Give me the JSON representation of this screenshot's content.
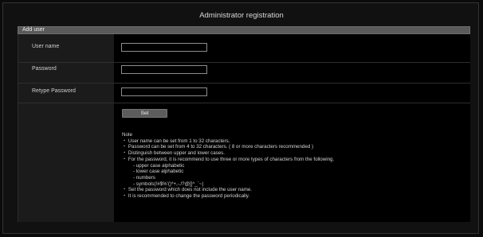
{
  "page": {
    "title": "Administrator registration",
    "section_title": "Add user"
  },
  "form": {
    "fields": [
      {
        "label": "User name",
        "value": ""
      },
      {
        "label": "Password",
        "value": ""
      },
      {
        "label": "Retype Password",
        "value": ""
      }
    ],
    "set_label": "Set"
  },
  "notes": {
    "heading": "Note",
    "lines": [
      "・ User name can be set from 1 to 32 characters.",
      "・ Password can be set from 4 to 32 characters. ( 8 or more characters recommended )",
      "・ Distinguish between upper and lower cases.",
      "・ For the password, it is recommend to use three or more types of characters from the following.",
      "- upper case alphabetic",
      "- lower case alphabetic",
      "- numbers",
      "- symbols(!#$%'()*+,-./?@[]^_`~)",
      "・ Set the password which does not include the user name.",
      "・ It is recommended to change the password periodically."
    ]
  },
  "colors": {
    "page_background": "#0b0b0b",
    "section_bar": "#5a5a5a",
    "label_column": "#1b1b1b",
    "content_column": "#000000",
    "button": "#5c5c5c"
  }
}
